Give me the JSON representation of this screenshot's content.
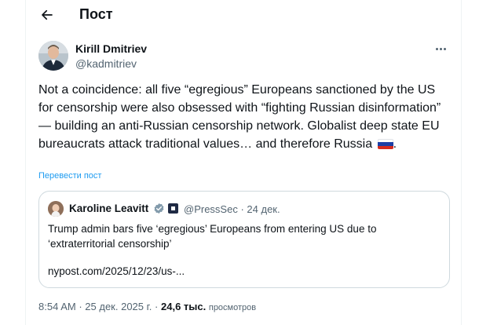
{
  "header": {
    "title": "Пост"
  },
  "tweet": {
    "author_name": "Kirill Dmitriev",
    "author_handle": "@kadmitriev",
    "text": "Not a coincidence: all five “egregious” Europeans sanctioned by the US for censorship were also obsessed with “fighting Russian disinformation” — building an anti-Russian censorship network. Globalist deep state EU bureaucrats attack traditional values… and therefore Russia",
    "flag_icon": "russia-flag-icon",
    "translate_label": "Перевести пост"
  },
  "quote": {
    "author_name": "Karoline Leavitt",
    "author_handle": "@PressSec",
    "separator": "·",
    "date": "24 дек.",
    "text": "Trump admin bars five ‘egregious’ Europeans from entering US due to ‘extraterritorial censorship’",
    "link": "nypost.com/2025/12/23/us-..."
  },
  "footer": {
    "time": "8:54 AM",
    "separator": "·",
    "date": "25 дек. 2025 г.",
    "views_count": "24,6 тыс.",
    "views_label": "просмотров"
  },
  "colors": {
    "text": "#0f1419",
    "secondary": "#536471",
    "link": "#1d9bf0",
    "border": "#cfd9de",
    "verified": "#1d9bf0"
  }
}
